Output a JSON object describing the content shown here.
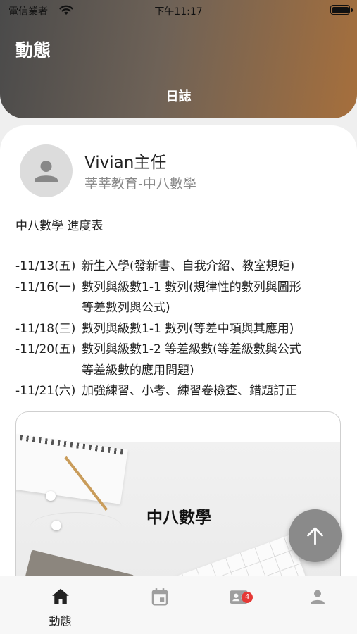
{
  "status_bar": {
    "carrier": "電信業者",
    "time": "下午11:17"
  },
  "header": {
    "title": "動態",
    "tab": "日誌"
  },
  "post": {
    "author_name": "Vivian主任",
    "author_org": "莘莘教育-中八數學",
    "title": "中八數學 進度表",
    "lines": [
      {
        "date": "-11/13(五)",
        "desc": "新生入學(發新書、自我介紹、教室規矩)"
      },
      {
        "date": "-11/16(一)",
        "desc": "數列與級數1-1 數列(規律性的數列與圖形"
      },
      {
        "date": "",
        "desc": "等差數列與公式)"
      },
      {
        "date": "-11/18(三)",
        "desc": "數列與級數1-1 數列(等差中項與其應用)"
      },
      {
        "date": "-11/20(五)",
        "desc": "數列與級數1-2 等差級數(等差級數與公式"
      },
      {
        "date": "",
        "desc": "等差級數的應用問題)"
      },
      {
        "date": "-11/21(六)",
        "desc": "加強練習、小考、練習卷檢查、錯題訂正"
      }
    ],
    "image_caption": "中八數學"
  },
  "bottom_nav": {
    "items": [
      {
        "label": "動態",
        "icon": "home-icon"
      },
      {
        "label": "",
        "icon": "calendar-icon"
      },
      {
        "label": "",
        "icon": "contact-card-icon",
        "badge": "4"
      },
      {
        "label": "",
        "icon": "person-icon"
      }
    ]
  },
  "colors": {
    "header_start": "#4a4a4a",
    "header_end": "#a66f3c",
    "badge": "#e53935",
    "fab": "#8a8a8a"
  }
}
